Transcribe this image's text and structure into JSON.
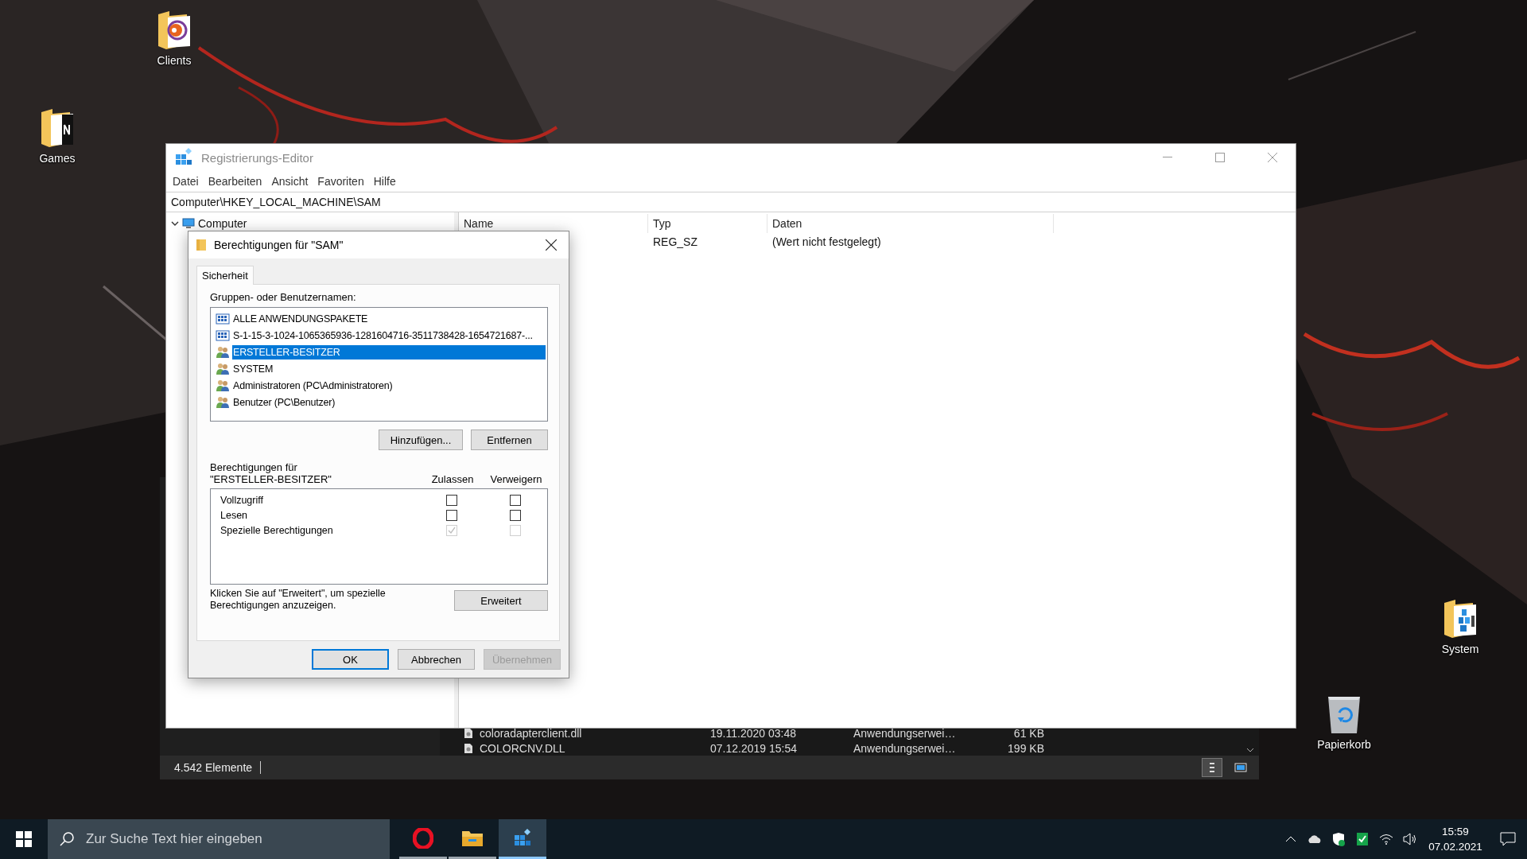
{
  "desktop": {
    "icons": [
      {
        "label": "Clients",
        "kind": "folder-disc"
      },
      {
        "label": "Games",
        "kind": "folder-doc"
      },
      {
        "label": "System",
        "kind": "folder-blocks"
      },
      {
        "label": "Papierkorb",
        "kind": "recycle-bin"
      }
    ]
  },
  "explorer": {
    "files": [
      {
        "name": "coloradapterclient.dll",
        "date": "19.11.2020 03:48",
        "type": "Anwendungserwei…",
        "size": "61 KB"
      },
      {
        "name": "COLORCNV.DLL",
        "date": "07.12.2019 15:54",
        "type": "Anwendungserwei…",
        "size": "199 KB"
      }
    ],
    "status": "4.542 Elemente",
    "views": [
      {
        "kind": "details",
        "selected": true
      },
      {
        "kind": "tiles",
        "selected": false
      }
    ]
  },
  "regedit": {
    "title": "Registrierungs-Editor",
    "menu": [
      "Datei",
      "Bearbeiten",
      "Ansicht",
      "Favoriten",
      "Hilfe"
    ],
    "address": "Computer\\HKEY_LOCAL_MACHINE\\SAM",
    "tree": [
      {
        "label": "Computer",
        "expanded": true
      }
    ],
    "columns": [
      "Name",
      "Typ",
      "Daten"
    ],
    "rows": [
      {
        "type": "REG_SZ",
        "data": "(Wert nicht festgelegt)"
      }
    ]
  },
  "dialog": {
    "title": "Berechtigungen für \"SAM\"",
    "tabs": [
      {
        "label": "Sicherheit",
        "selected": true
      }
    ],
    "groups_label": "Gruppen- oder Benutzernamen:",
    "principals": [
      {
        "name": "ALLE ANWENDUNGSPAKETE",
        "kind": "package",
        "selected": false
      },
      {
        "name": "S-1-15-3-1024-1065365936-1281604716-3511738428-1654721687-...",
        "kind": "package",
        "selected": false
      },
      {
        "name": "ERSTELLER-BESITZER",
        "kind": "user",
        "selected": true
      },
      {
        "name": "SYSTEM",
        "kind": "user",
        "selected": false
      },
      {
        "name": "Administratoren (PC\\Administratoren)",
        "kind": "user",
        "selected": false
      },
      {
        "name": "Benutzer (PC\\Benutzer)",
        "kind": "user",
        "selected": false
      }
    ],
    "list_buttons": [
      "Hinzufügen...",
      "Entfernen"
    ],
    "permissions_label": [
      "Berechtigungen für",
      "\"ERSTELLER-BESITZER\""
    ],
    "permission_columns": [
      "Zulassen",
      "Verweigern"
    ],
    "permissions": [
      {
        "name": "Vollzugriff",
        "allow": {
          "checked": false,
          "disabled": false
        },
        "deny": {
          "checked": false,
          "disabled": false
        }
      },
      {
        "name": "Lesen",
        "allow": {
          "checked": false,
          "disabled": false
        },
        "deny": {
          "checked": false,
          "disabled": false
        }
      },
      {
        "name": "Spezielle Berechtigungen",
        "allow": {
          "checked": true,
          "disabled": true
        },
        "deny": {
          "checked": false,
          "disabled": true
        }
      }
    ],
    "hint": "Klicken Sie auf \"Erweitert\", um spezielle Berechtigungen anzuzeigen.",
    "advanced_button": "Erweitert",
    "footer_buttons": [
      {
        "label": "OK",
        "default": true,
        "disabled": false
      },
      {
        "label": "Abbrechen",
        "default": false,
        "disabled": false
      },
      {
        "label": "Übernehmen",
        "default": false,
        "disabled": true
      }
    ]
  },
  "taskbar": {
    "search": {
      "placeholder": "Zur Suche Text hier eingeben"
    },
    "apps": [
      {
        "kind": "opera",
        "active": false
      },
      {
        "kind": "explorer",
        "active": false
      },
      {
        "kind": "regedit",
        "active": true
      }
    ],
    "time": "15:59",
    "date": "07.02.2021"
  }
}
